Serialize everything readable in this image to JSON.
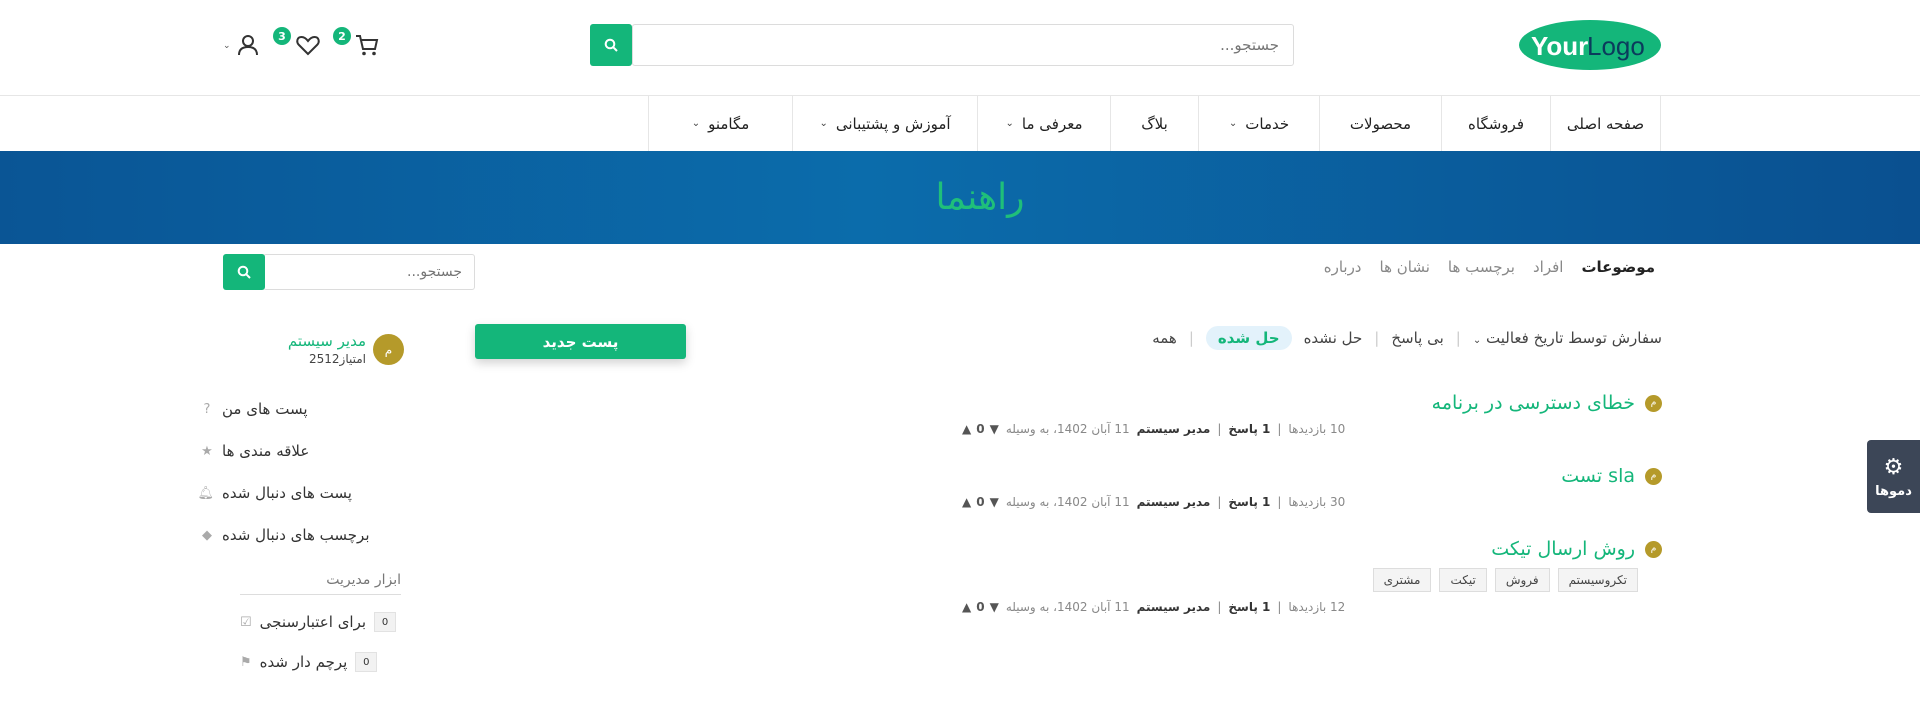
{
  "header": {
    "logo": {
      "part1": "Your",
      "part2": "Logo"
    },
    "search": {
      "placeholder": "جستجو...",
      "button_icon": "search-icon"
    },
    "cart": {
      "icon": "cart-icon",
      "count": "2"
    },
    "wishlist": {
      "icon": "heart-icon",
      "count": "3"
    },
    "account": {
      "icon": "user-icon",
      "chevron": "chevron-down-icon"
    }
  },
  "nav": {
    "items": [
      {
        "label": "صفحه اصلی",
        "dropdown": false
      },
      {
        "label": "فروشگاه",
        "dropdown": false
      },
      {
        "label": "محصولات",
        "dropdown": false
      },
      {
        "label": "خدمات",
        "dropdown": true
      },
      {
        "label": "بلاگ",
        "dropdown": false
      },
      {
        "label": "معرفی ما",
        "dropdown": true
      },
      {
        "label": "آموزش و پشتیبانی",
        "dropdown": true
      },
      {
        "label": "مگامنو",
        "dropdown": true
      }
    ]
  },
  "banner": {
    "title": "راهنما"
  },
  "subtabs": [
    "موضوعات",
    "افراد",
    "برچسب ها",
    "نشان ها",
    "درباره"
  ],
  "side_search": {
    "placeholder": "جستجو..."
  },
  "filters": {
    "all": "همه",
    "solved": "حل شده",
    "unsolved": "حل نشده",
    "unanswered": "بی پاسخ",
    "sort": "سفارش توسط تاریخ فعالیت"
  },
  "new_post": "پست جدید",
  "posts": [
    {
      "title": "خطای دسترسی در برنامه",
      "votes": "0",
      "date": "11 آبان 1402، به وسیله",
      "author": "مدیر سیستم",
      "answers": "1 پاسخ",
      "views": "10 بازدیدها",
      "tags": []
    },
    {
      "title": "تست sla",
      "votes": "0",
      "date": "11 آبان 1402، به وسیله",
      "author": "مدیر سیستم",
      "answers": "1 پاسخ",
      "views": "30 بازدیدها",
      "tags": []
    },
    {
      "title": "روش ارسال تیکت",
      "votes": "0",
      "date": "11 آبان 1402، به وسیله",
      "author": "مدیر سیستم",
      "answers": "1 پاسخ",
      "views": "12 بازدیدها",
      "tags": [
        "تکروسیستم",
        "فروش",
        "تیکت",
        "مشتری"
      ]
    }
  ],
  "user": {
    "avatar": "م",
    "name": "مدیر سیستم",
    "points": "2512امتیاز"
  },
  "side_menu": [
    {
      "label": "پست های من",
      "icon": "question-circle-icon"
    },
    {
      "label": "علاقه مندی ها",
      "icon": "star-icon"
    },
    {
      "label": "پست های دنبال شده",
      "icon": "bell-icon"
    },
    {
      "label": "برچسب های دنبال شده",
      "icon": "tags-icon"
    }
  ],
  "admin": {
    "title": "ابزار مدیریت",
    "validation": {
      "label": "برای اعتبارسنجی",
      "count": "0",
      "icon": "check-square-icon"
    },
    "flagged": {
      "label": "پرچم دار شده",
      "count": "0",
      "icon": "flag-icon"
    }
  },
  "demos": {
    "label": "دموها",
    "icon": "gear-icon"
  },
  "colors": {
    "accent": "#14b67a",
    "banner": "#0b6cab",
    "avatar": "#b59a2a"
  }
}
